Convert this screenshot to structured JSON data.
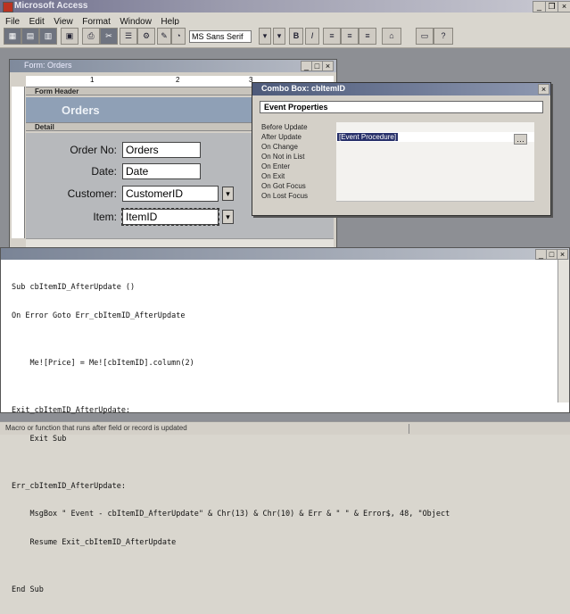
{
  "app": {
    "window_title": "Microsoft Access"
  },
  "menu": [
    "File",
    "Edit",
    "View",
    "Format",
    "Window",
    "Help"
  ],
  "toolbar": {
    "font_name": "MS Sans Serif",
    "bold": "B",
    "italic": "I"
  },
  "form_window": {
    "title": "Form: Orders",
    "ruler": [
      "1",
      "2",
      "3"
    ],
    "header_section": "Form Header",
    "header_title": "Orders",
    "detail_section": "Detail",
    "fields": [
      {
        "label": "Order No:",
        "value": "Orders"
      },
      {
        "label": "Date:",
        "value": "Date"
      },
      {
        "label": "Customer:",
        "value": "CustomerID"
      },
      {
        "label": "Item:",
        "value": "ItemID"
      }
    ]
  },
  "property_sheet": {
    "title": "Combo Box: cbItemID",
    "tab": "Event Properties",
    "rows": [
      {
        "name": "Before Update",
        "value": ""
      },
      {
        "name": "After Update",
        "value": "[Event Procedure]"
      },
      {
        "name": "On Change",
        "value": ""
      },
      {
        "name": "On Not in List",
        "value": ""
      },
      {
        "name": "On Enter",
        "value": ""
      },
      {
        "name": "On Exit",
        "value": ""
      },
      {
        "name": "On Got Focus",
        "value": ""
      },
      {
        "name": "On Lost Focus",
        "value": ""
      }
    ]
  },
  "code_window": {
    "lines": [
      "Sub cbItemID_AfterUpdate ()",
      "On Error Goto Err_cbItemID_AfterUpdate",
      "",
      "    Me![Price] = Me![cbItemID].column(2)",
      "",
      "Exit_cbItemID_AfterUpdate:",
      "    Exit Sub",
      "",
      "Err_cbItemID_AfterUpdate:",
      "    MsgBox \" Event - cbItemID_AfterUpdate\" & Chr(13) & Chr(10) & Err & \" \" & Error$, 48, \"Object",
      "    Resume Exit_cbItemID_AfterUpdate",
      "",
      "End Sub"
    ]
  },
  "status": {
    "text": "Macro or function that runs after field or record is updated"
  }
}
